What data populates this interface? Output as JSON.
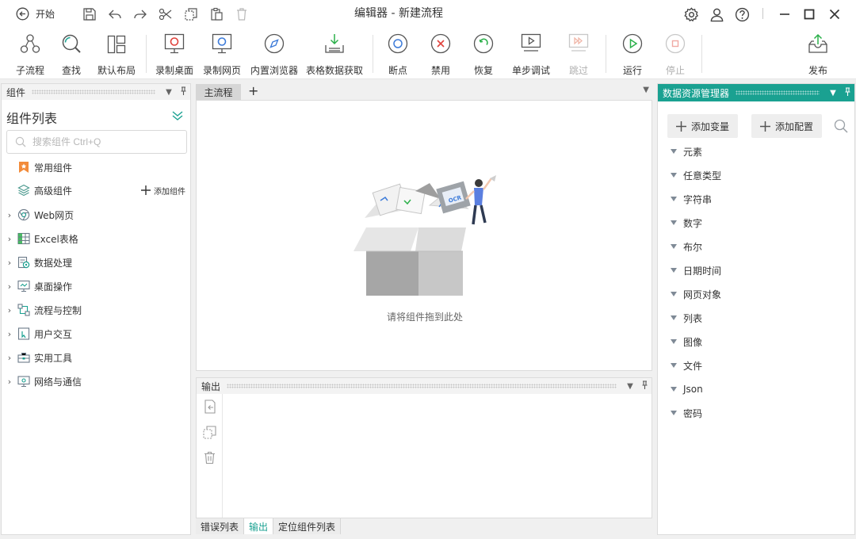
{
  "titlebar": {
    "start_label": "开始",
    "title": "编辑器 - 新建流程"
  },
  "ribbon": [
    {
      "label": "子流程",
      "icon": "subflow-icon",
      "disabled": false
    },
    {
      "label": "查找",
      "icon": "find-icon",
      "disabled": false
    },
    {
      "label": "默认布局",
      "icon": "layout-icon",
      "disabled": false
    },
    {
      "label": "录制桌面",
      "icon": "record-desktop-icon",
      "disabled": false
    },
    {
      "label": "录制网页",
      "icon": "record-web-icon",
      "disabled": false
    },
    {
      "label": "内置浏览器",
      "icon": "browser-icon",
      "disabled": false
    },
    {
      "label": "表格数据获取",
      "icon": "table-data-icon",
      "disabled": false
    },
    {
      "label": "断点",
      "icon": "breakpoint-icon",
      "disabled": false
    },
    {
      "label": "禁用",
      "icon": "disable-icon",
      "disabled": false
    },
    {
      "label": "恢复",
      "icon": "restore-icon",
      "disabled": false
    },
    {
      "label": "单步调试",
      "icon": "step-debug-icon",
      "disabled": false
    },
    {
      "label": "跳过",
      "icon": "skip-icon",
      "disabled": true
    },
    {
      "label": "运行",
      "icon": "run-icon",
      "disabled": false
    },
    {
      "label": "停止",
      "icon": "stop-icon",
      "disabled": true
    },
    {
      "label": "发布",
      "icon": "publish-icon",
      "disabled": false
    }
  ],
  "components_panel": {
    "header": "组件",
    "title": "组件列表",
    "search_placeholder": "搜索组件 Ctrl+Q",
    "pinned": [
      {
        "label": "常用组件",
        "icon": "bookmark-icon"
      },
      {
        "label": "高级组件",
        "icon": "layers-icon"
      }
    ],
    "add_component": "添加组件",
    "groups": [
      {
        "label": "Web网页",
        "icon": "web-icon"
      },
      {
        "label": "Excel表格",
        "icon": "excel-icon"
      },
      {
        "label": "数据处理",
        "icon": "data-processing-icon"
      },
      {
        "label": "桌面操作",
        "icon": "desktop-icon"
      },
      {
        "label": "流程与控制",
        "icon": "flow-control-icon"
      },
      {
        "label": "用户交互",
        "icon": "user-interaction-icon"
      },
      {
        "label": "实用工具",
        "icon": "toolbox-icon"
      },
      {
        "label": "网络与通信",
        "icon": "network-icon"
      }
    ]
  },
  "editor": {
    "tab": "主流程",
    "add_tab": "+",
    "empty_hint": "请将组件拖到此处"
  },
  "output_panel": {
    "header": "输出"
  },
  "bottom_tabs": [
    {
      "label": "错误列表",
      "active": false
    },
    {
      "label": "输出",
      "active": true
    },
    {
      "label": "定位组件列表",
      "active": false
    }
  ],
  "data_panel": {
    "header": "数据资源管理器",
    "add_variable": "添加变量",
    "add_config": "添加配置",
    "types": [
      "元素",
      "任意类型",
      "字符串",
      "数字",
      "布尔",
      "日期时间",
      "网页对象",
      "列表",
      "图像",
      "文件",
      "Json",
      "密码"
    ]
  },
  "colors": {
    "accent": "#1aa191",
    "record_red": "#e0423c",
    "run_green": "#2bb04a",
    "debug_blue": "#3d7bd9"
  }
}
